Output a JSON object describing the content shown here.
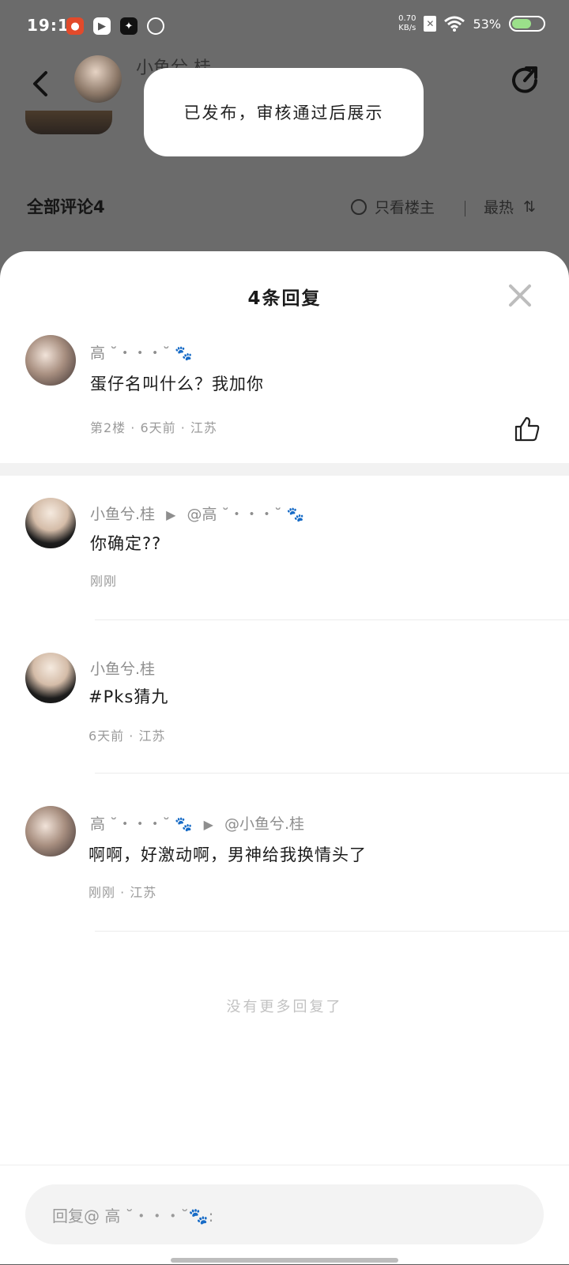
{
  "status": {
    "time": "19:15",
    "net_speed_value": "0.70",
    "net_speed_unit": "KB/s",
    "battery": "53%",
    "battery_level": 0.53
  },
  "background": {
    "author_name": "小鱼兮.桂",
    "comments_header": "全部评论4",
    "only_op_label": "只看楼主",
    "sort_label": "最热"
  },
  "toast": {
    "text": "已发布，审核通过后展示"
  },
  "sheet": {
    "title": "4条回复",
    "main_comment": {
      "name": "高",
      "name_deco": "˘・・・˘",
      "text": "蛋仔名叫什么？我加你",
      "meta": "第2楼 · 6天前 · 江苏"
    },
    "replies": [
      {
        "name": "小鱼兮.桂",
        "target": "@高",
        "target_deco": "˘・・・˘",
        "text": "你确定??",
        "meta": "刚刚"
      },
      {
        "name": "小鱼兮.桂",
        "text": "#Pks猜九",
        "meta": "6天前 · 江苏"
      },
      {
        "name": "高",
        "name_deco": "˘・・・˘",
        "target": "@小鱼兮.桂",
        "text": "啊啊，好激动啊，男神给我换情头了",
        "meta": "刚刚 · 江苏"
      }
    ],
    "no_more": "没有更多回复了",
    "input_placeholder": "回复@ 高 ˘・・・˘🐾:"
  }
}
